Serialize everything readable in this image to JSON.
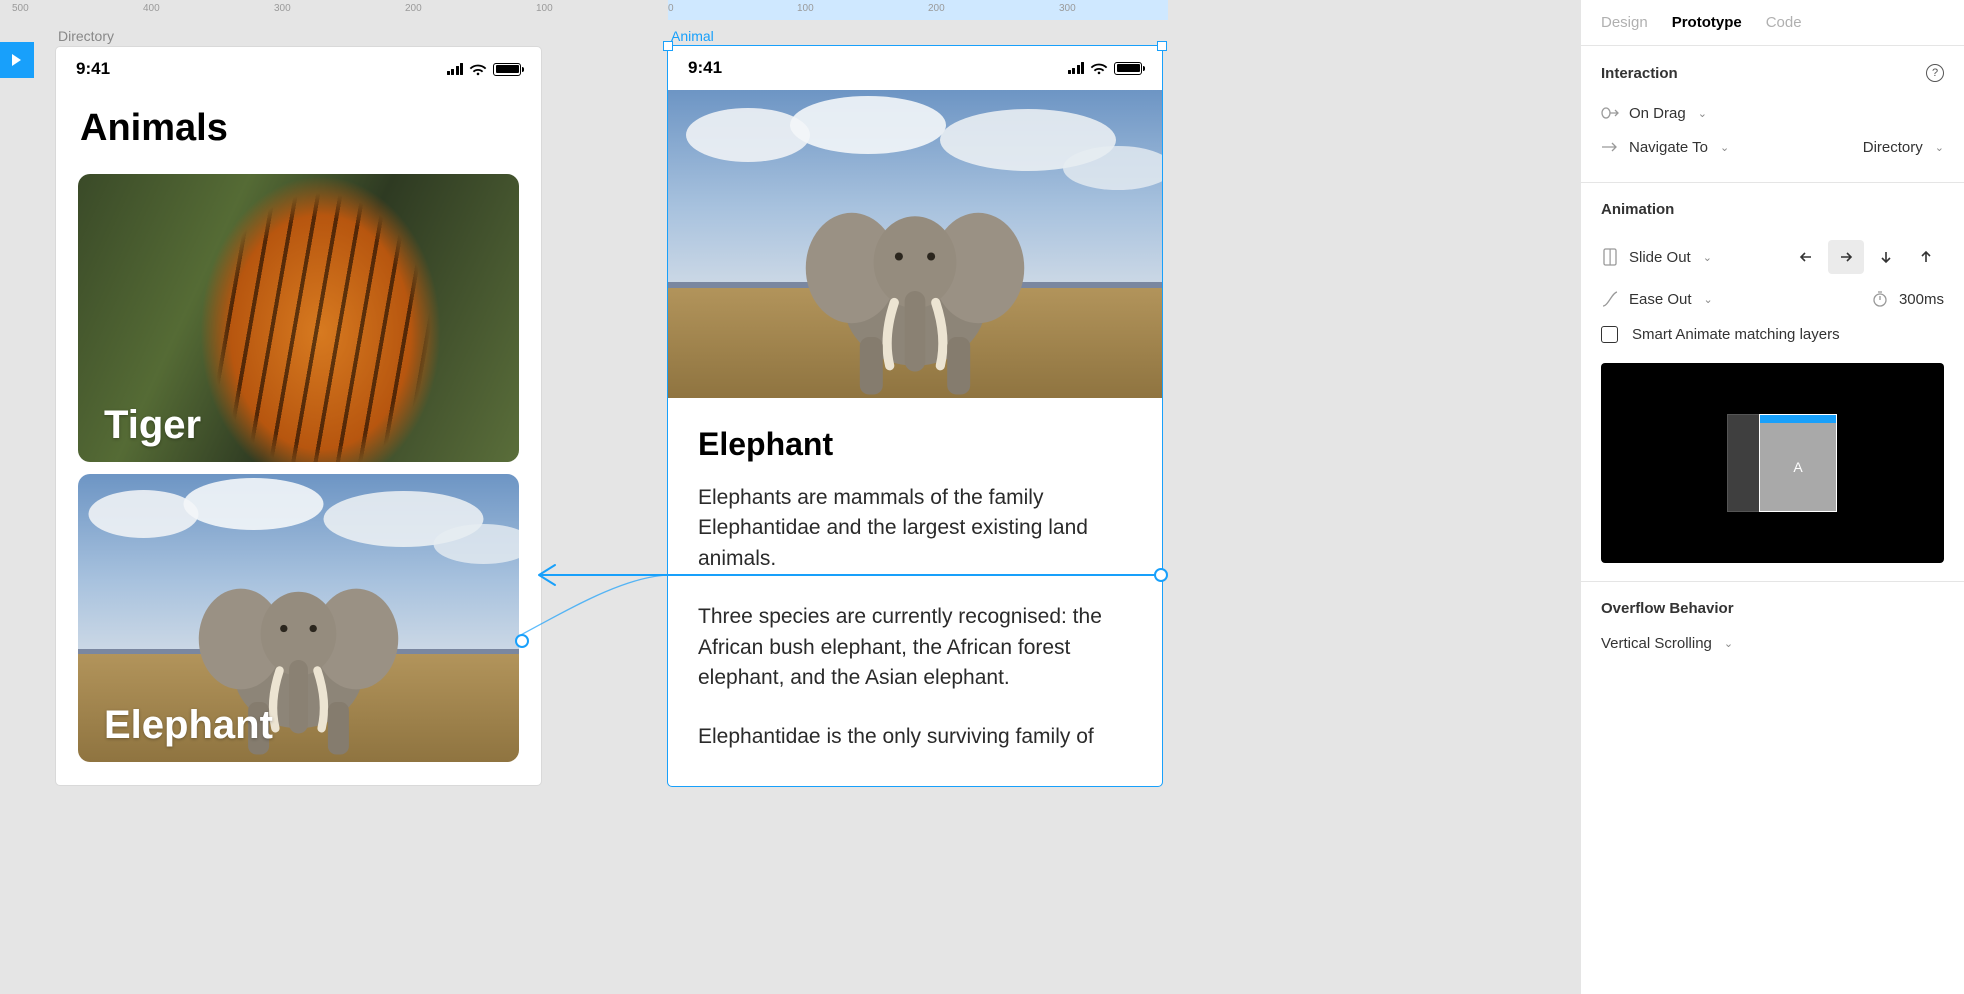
{
  "ruler": {
    "ticks": [
      "500",
      "400",
      "300",
      "200",
      "100",
      "0",
      "100",
      "200",
      "300"
    ]
  },
  "frames": {
    "directory": {
      "label": "Directory",
      "time": "9:41",
      "title": "Animals",
      "cards": [
        {
          "title": "Tiger"
        },
        {
          "title": "Elephant"
        }
      ]
    },
    "animal": {
      "label": "Animal",
      "time": "9:41",
      "title": "Elephant",
      "paragraphs": [
        "Elephants are mammals of the family Elephantidae and the largest existing land animals.",
        "Three species are currently recognised: the African bush elephant, the African forest elephant, and the Asian elephant.",
        "Elephantidae is the only surviving family of"
      ]
    }
  },
  "panel": {
    "tabs": {
      "design": "Design",
      "prototype": "Prototype",
      "code": "Code",
      "active": "prototype"
    },
    "interaction": {
      "title": "Interaction",
      "trigger": "On Drag",
      "action": "Navigate To",
      "target": "Directory"
    },
    "animation": {
      "title": "Animation",
      "type": "Slide Out",
      "easing": "Ease Out",
      "duration": "300ms",
      "smart_animate": "Smart Animate matching layers",
      "preview_letter": "A"
    },
    "overflow": {
      "title": "Overflow Behavior",
      "value": "Vertical Scrolling"
    }
  }
}
